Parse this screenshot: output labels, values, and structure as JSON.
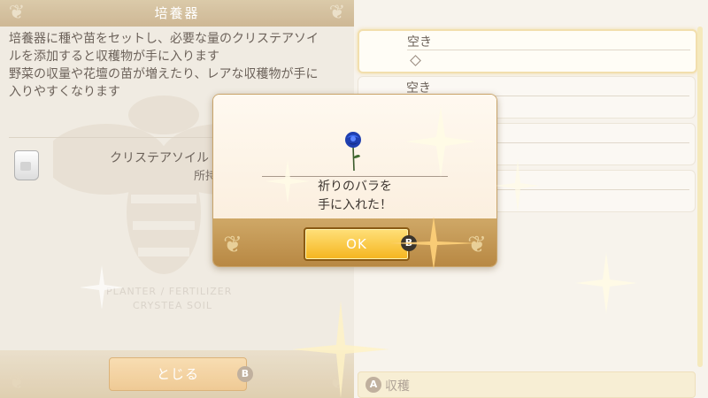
{
  "left_panel": {
    "title": "培養器",
    "description": [
      "培養器に種や苗をセットし、必要な量のクリステアソイ",
      "ルを添加すると収穫物が手に入ります",
      "野菜の収量や花壇の苗が増えたり、レアな収穫物が手に",
      "入りやすくなります"
    ],
    "item": {
      "name": "クリステアソイル",
      "owned_label": "所持"
    },
    "faint_text": [
      "PLANTER / FERTILIZER",
      "CRYSTEA SOIL"
    ],
    "close_button": "とじる",
    "close_button_hint": "B"
  },
  "right_panel": {
    "slots": [
      {
        "label": "空き",
        "has_marker": true
      },
      {
        "label": "空き",
        "has_marker": false
      },
      {
        "label": "",
        "has_marker": false
      },
      {
        "label": "",
        "has_marker": false
      }
    ],
    "harvest_hint": "A",
    "harvest_label": "収穫"
  },
  "dialog": {
    "message_line1": "祈りのバラを",
    "message_line2": "手に入れた！",
    "item_icon": "blue-rose-icon",
    "ok_button": "OK",
    "ok_button_hint": "B"
  },
  "colors": {
    "accent_gold": "#f5b51e",
    "panel_header": "#c9b089",
    "rose_blue": "#1f3fb0"
  }
}
